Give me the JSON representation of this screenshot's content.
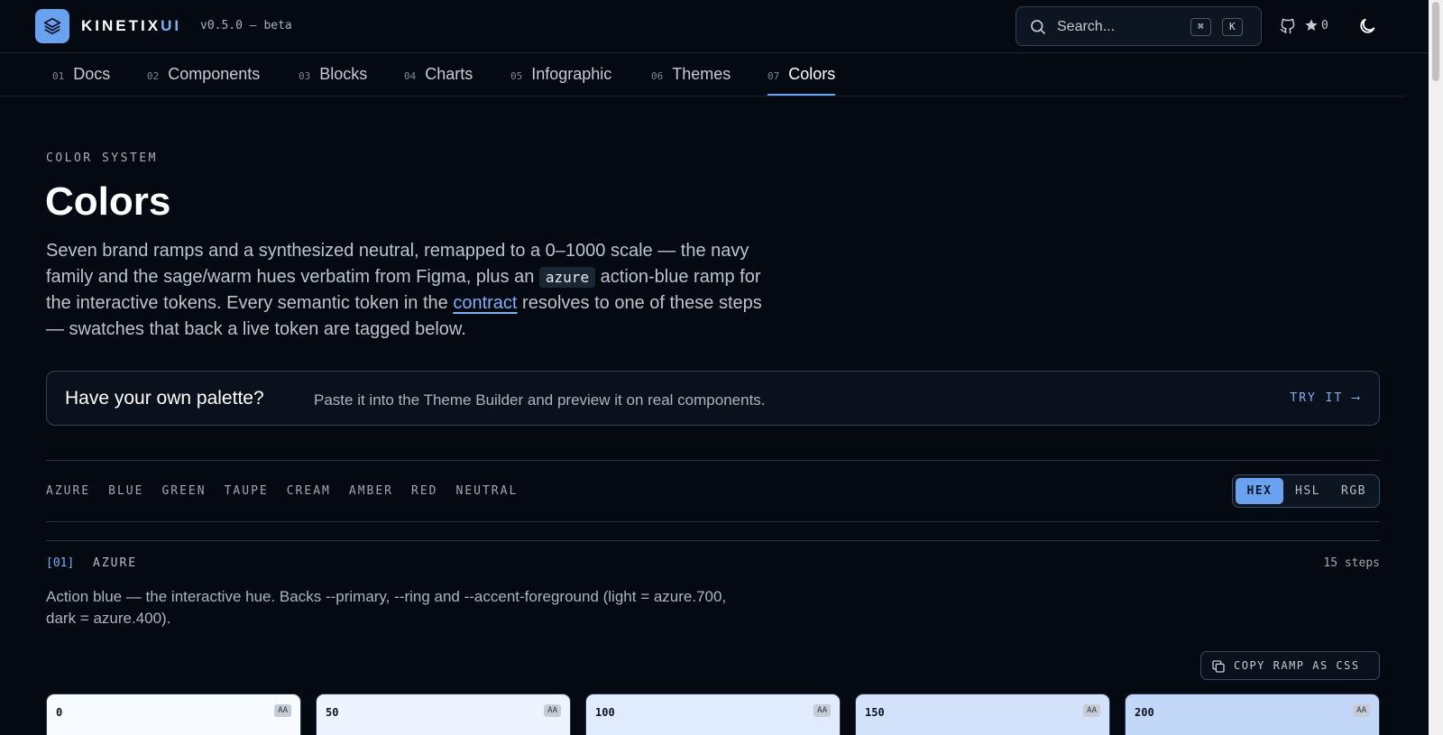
{
  "header": {
    "brand_main": "KINETIX",
    "brand_accent": "UI",
    "version": "v0.5.0 — beta",
    "search_placeholder": "Search...",
    "kbd_cmd": "⌘",
    "kbd_k": "K",
    "star_count": "0",
    "icons": [
      "layers-icon",
      "search-icon",
      "github-icon",
      "star-icon",
      "moon-icon"
    ]
  },
  "nav": {
    "items": [
      {
        "num": "01",
        "label": "Docs"
      },
      {
        "num": "02",
        "label": "Components"
      },
      {
        "num": "03",
        "label": "Blocks"
      },
      {
        "num": "04",
        "label": "Charts"
      },
      {
        "num": "05",
        "label": "Infographic"
      },
      {
        "num": "06",
        "label": "Themes"
      },
      {
        "num": "07",
        "label": "Colors"
      }
    ],
    "active": "Colors"
  },
  "hero": {
    "eyebrow": "COLOR SYSTEM",
    "title": "Colors",
    "lead_1": "Seven brand ramps and a synthesized neutral, remapped to a 0–1000 scale — the navy family and the sage/warm hues verbatim from Figma, plus an ",
    "lead_code": "azure",
    "lead_2": " action-blue ramp for the interactive tokens. Every semantic token in the ",
    "lead_link": "contract",
    "lead_3": " resolves to one of these steps — swatches that back a live token are tagged below."
  },
  "cta": {
    "heading": "Have your own palette?",
    "sub": "Paste it into the Theme Builder and preview it on real components.",
    "action": "TRY IT ⟶"
  },
  "filters": [
    "AZURE",
    "BLUE",
    "GREEN",
    "TAUPE",
    "CREAM",
    "AMBER",
    "RED",
    "NEUTRAL"
  ],
  "format": {
    "options": [
      "HEX",
      "HSL",
      "RGB"
    ],
    "selected": "HEX"
  },
  "section": {
    "num": "[01]",
    "name": "AZURE",
    "steps": "15 steps",
    "description": "Action blue — the interactive hue. Backs --primary, --ring and --accent-foreground (light = azure.700, dark = azure.400).",
    "copy_label": "COPY RAMP AS CSS",
    "swatches": [
      {
        "step": "0",
        "badge": "AA",
        "color": "#f7faff"
      },
      {
        "step": "50",
        "badge": "AA",
        "color": "#eef4ff"
      },
      {
        "step": "100",
        "badge": "AA",
        "color": "#e0ebfd"
      },
      {
        "step": "150",
        "badge": "AA",
        "color": "#d2e2fb"
      },
      {
        "step": "200",
        "badge": "AA",
        "color": "#c3d8f9"
      }
    ]
  },
  "colors": {
    "accent": "#6aa2ef",
    "background": "#050a12",
    "border": "#334257"
  }
}
